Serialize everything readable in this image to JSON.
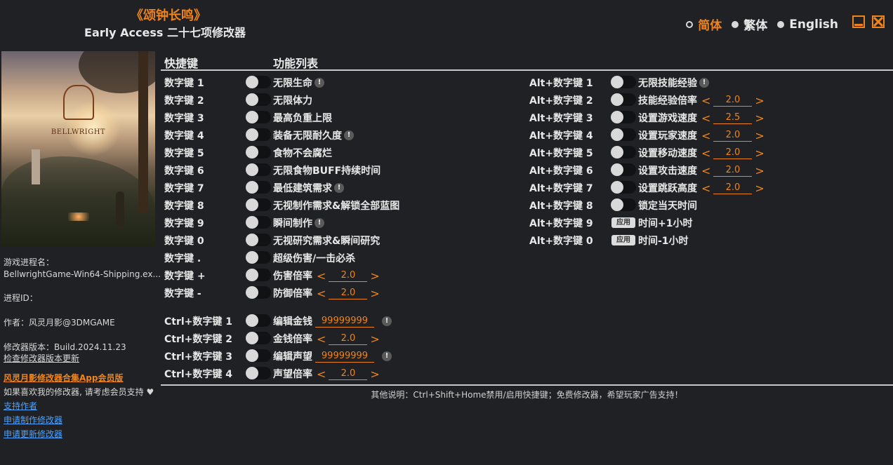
{
  "header": {
    "game_title": "《颂钟长鸣》",
    "subtitle": "Early Access 二十七项修改器"
  },
  "languages": [
    {
      "label": "简体",
      "selected": true
    },
    {
      "label": "繁体",
      "selected": false
    },
    {
      "label": "English",
      "selected": false
    }
  ],
  "window_controls": {
    "minimize": "minimize-icon",
    "close": "close-icon"
  },
  "cover": {
    "logo_text": "BELLWRIGHT"
  },
  "sidebar": {
    "process_name_label": "游戏进程名：",
    "process_name_value": "BellwrightGame-Win64-Shipping.ex...",
    "process_id_label": "进程ID：",
    "author": "作者：风灵月影@3DMGAME",
    "version": "修改器版本：Build.2024.11.23",
    "check_update": "检查修改器版本更新",
    "app_promo": "风灵月影修改器合集App会员版",
    "support_text": "如果喜欢我的修改器, 请考虑会员支持",
    "heart": "♥",
    "support_author": "支持作者",
    "request_trainer": "申请制作修改器",
    "request_update": "申请更新修改器"
  },
  "table": {
    "col_hotkey": "快捷键",
    "col_function": "功能列表"
  },
  "warn_symbol": "!",
  "left_rows": [
    {
      "key": "数字键 1",
      "label": "无限生命",
      "warn": true
    },
    {
      "key": "数字键 2",
      "label": "无限体力"
    },
    {
      "key": "数字键 3",
      "label": "最高负重上限"
    },
    {
      "key": "数字键 4",
      "label": "装备无限耐久度",
      "warn": true
    },
    {
      "key": "数字键 5",
      "label": "食物不会腐烂"
    },
    {
      "key": "数字键 6",
      "label": "无限食物BUFF持续时间"
    },
    {
      "key": "数字键 7",
      "label": "最低建筑需求",
      "warn": true
    },
    {
      "key": "数字键 8",
      "label": "无视制作需求&解锁全部蓝图"
    },
    {
      "key": "数字键 9",
      "label": "瞬间制作",
      "warn": true
    },
    {
      "key": "数字键 0",
      "label": "无视研究需求&瞬间研究"
    },
    {
      "key": "数字键 .",
      "label": "超级伤害/一击必杀"
    },
    {
      "key": "数字键 +",
      "label": "伤害倍率",
      "value": "2.0"
    },
    {
      "key": "数字键 -",
      "label": "防御倍率",
      "value": "2.0"
    }
  ],
  "ctrl_rows": [
    {
      "key": "Ctrl+数字键 1",
      "label": "编辑金钱",
      "edit": "99999999",
      "warn": true
    },
    {
      "key": "Ctrl+数字键 2",
      "label": "金钱倍率",
      "value": "2.0"
    },
    {
      "key": "Ctrl+数字键 3",
      "label": "编辑声望",
      "edit": "99999999",
      "warn": true
    },
    {
      "key": "Ctrl+数字键 4",
      "label": "声望倍率",
      "value": "2.0"
    }
  ],
  "alt_rows": [
    {
      "key": "Alt+数字键 1",
      "label": "无限技能经验",
      "warn": true
    },
    {
      "key": "Alt+数字键 2",
      "label": "技能经验倍率",
      "value": "2.0"
    },
    {
      "key": "Alt+数字键 3",
      "label": "设置游戏速度",
      "value": "2.5"
    },
    {
      "key": "Alt+数字键 4",
      "label": "设置玩家速度",
      "value": "2.0"
    },
    {
      "key": "Alt+数字键 5",
      "label": "设置移动速度",
      "value": "2.0"
    },
    {
      "key": "Alt+数字键 6",
      "label": "设置攻击速度",
      "value": "2.0"
    },
    {
      "key": "Alt+数字键 7",
      "label": "设置跳跃高度",
      "value": "2.0"
    },
    {
      "key": "Alt+数字键 8",
      "label": "锁定当天时间"
    },
    {
      "key": "Alt+数字键 9",
      "label": "时间+1小时",
      "apply": "应用"
    },
    {
      "key": "Alt+数字键 0",
      "label": "时间-1小时",
      "apply": "应用"
    }
  ],
  "stepper": {
    "left": "<",
    "right": ">"
  },
  "footer": "其他说明：Ctrl+Shift+Home禁用/启用快捷键；免费修改器，希望玩家广告支持！"
}
